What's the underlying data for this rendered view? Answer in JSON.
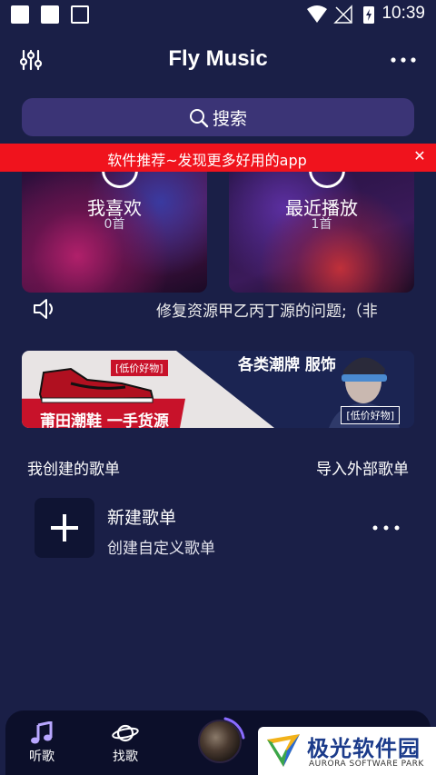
{
  "status_bar": {
    "time": "10:39"
  },
  "header": {
    "title": "Fly Music"
  },
  "search": {
    "label": "搜索"
  },
  "ad_bar": {
    "text": "软件推荐~发现更多好用的app",
    "close": "✕"
  },
  "cards": [
    {
      "label": "我喜欢",
      "count": "0首"
    },
    {
      "label": "最近播放",
      "count": "1首"
    }
  ],
  "notice": {
    "text": "修复资源甲乙丙丁源的问题;（非"
  },
  "promo": {
    "tag_left": "[低价好物]",
    "headline_left": "莆田潮鞋 一手货源",
    "headline_right": "各类潮牌 服饰",
    "tag_right": "[低价好物]"
  },
  "section": {
    "title": "我创建的歌单",
    "action": "导入外部歌单"
  },
  "playlist_new": {
    "title": "新建歌单",
    "subtitle": "创建自定义歌单"
  },
  "nav": [
    {
      "label": "听歌",
      "icon": "music-note-icon"
    },
    {
      "label": "找歌",
      "icon": "planet-icon"
    }
  ],
  "watermark": {
    "title": "极光软件园",
    "subtitle": "AURORA SOFTWARE PARK"
  },
  "colors": {
    "background": "#1a1f47",
    "search_bg": "#3b3476",
    "ad_red": "#f0131d",
    "nav_bg": "#0c0f2a"
  }
}
